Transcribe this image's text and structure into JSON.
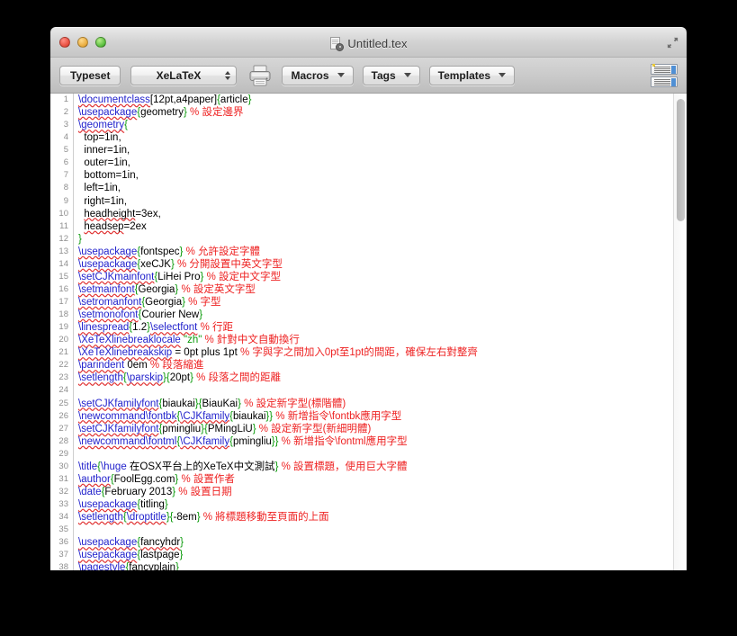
{
  "window": {
    "title": "Untitled.tex",
    "doc_icon": "tex-document-icon",
    "expand_icon": "expand-arrows-icon",
    "close_label": "close",
    "minimize_label": "minimize",
    "zoom_label": "zoom"
  },
  "toolbar": {
    "typeset_label": "Typeset",
    "engine_value": "XeLaTeX",
    "print_icon": "printer-icon",
    "macros_label": "Macros",
    "tags_label": "Tags",
    "templates_label": "Templates",
    "layout_toggle_icon": "split-view-icon"
  },
  "editor": {
    "line_count": 38,
    "first_visible_line": 1,
    "lines": [
      {
        "n": 1,
        "tokens": [
          {
            "c": "cmd-s",
            "t": "\\documentclass"
          },
          {
            "c": "txt",
            "t": "[12pt,a4paper]"
          },
          {
            "c": "br",
            "t": "{"
          },
          {
            "c": "txt",
            "t": "article"
          },
          {
            "c": "br",
            "t": "}"
          }
        ]
      },
      {
        "n": 2,
        "tokens": [
          {
            "c": "cmd-s",
            "t": "\\usepackage"
          },
          {
            "c": "br",
            "t": "{"
          },
          {
            "c": "txt",
            "t": "geometry"
          },
          {
            "c": "br",
            "t": "}"
          },
          {
            "c": "cmt",
            "t": " % 設定邊界"
          }
        ]
      },
      {
        "n": 3,
        "tokens": [
          {
            "c": "cmd-s",
            "t": "\\geometry"
          },
          {
            "c": "br",
            "t": "{"
          }
        ]
      },
      {
        "n": 4,
        "tokens": [
          {
            "c": "txt",
            "t": "  top=1in,"
          }
        ]
      },
      {
        "n": 5,
        "tokens": [
          {
            "c": "txt",
            "t": "  inner=1in,"
          }
        ]
      },
      {
        "n": 6,
        "tokens": [
          {
            "c": "txt",
            "t": "  outer=1in,"
          }
        ]
      },
      {
        "n": 7,
        "tokens": [
          {
            "c": "txt",
            "t": "  bottom=1in,"
          }
        ]
      },
      {
        "n": 8,
        "tokens": [
          {
            "c": "txt",
            "t": "  left=1in,"
          }
        ]
      },
      {
        "n": 9,
        "tokens": [
          {
            "c": "txt",
            "t": "  right=1in,"
          }
        ]
      },
      {
        "n": 10,
        "tokens": [
          {
            "c": "txt",
            "t": "  "
          },
          {
            "c": "sp",
            "t": "headheight"
          },
          {
            "c": "txt",
            "t": "=3ex,"
          }
        ]
      },
      {
        "n": 11,
        "tokens": [
          {
            "c": "txt",
            "t": "  "
          },
          {
            "c": "sp",
            "t": "headsep"
          },
          {
            "c": "txt",
            "t": "=2ex"
          }
        ]
      },
      {
        "n": 12,
        "tokens": [
          {
            "c": "br",
            "t": "}"
          }
        ]
      },
      {
        "n": 13,
        "tokens": [
          {
            "c": "cmd-s",
            "t": "\\usepackage"
          },
          {
            "c": "br",
            "t": "{"
          },
          {
            "c": "txt",
            "t": "fontspec"
          },
          {
            "c": "br",
            "t": "}"
          },
          {
            "c": "cmt",
            "t": " % 允許設定字體"
          }
        ]
      },
      {
        "n": 14,
        "tokens": [
          {
            "c": "cmd-s",
            "t": "\\usepackage"
          },
          {
            "c": "br",
            "t": "{"
          },
          {
            "c": "txt",
            "t": "xeCJK"
          },
          {
            "c": "br",
            "t": "}"
          },
          {
            "c": "cmt",
            "t": " % 分開設置中英文字型"
          }
        ]
      },
      {
        "n": 15,
        "tokens": [
          {
            "c": "cmd-s",
            "t": "\\setCJKmainfont"
          },
          {
            "c": "br",
            "t": "{"
          },
          {
            "c": "txt",
            "t": "LiHei Pro"
          },
          {
            "c": "br",
            "t": "}"
          },
          {
            "c": "cmt",
            "t": " % 設定中文字型"
          }
        ]
      },
      {
        "n": 16,
        "tokens": [
          {
            "c": "cmd-s",
            "t": "\\setmainfont"
          },
          {
            "c": "br",
            "t": "{"
          },
          {
            "c": "txt",
            "t": "Georgia"
          },
          {
            "c": "br",
            "t": "}"
          },
          {
            "c": "cmt",
            "t": " % 設定英文字型"
          }
        ]
      },
      {
        "n": 17,
        "tokens": [
          {
            "c": "cmd-s",
            "t": "\\setromanfont"
          },
          {
            "c": "br",
            "t": "{"
          },
          {
            "c": "txt",
            "t": "Georgia"
          },
          {
            "c": "br",
            "t": "}"
          },
          {
            "c": "cmt",
            "t": " % 字型"
          }
        ]
      },
      {
        "n": 18,
        "tokens": [
          {
            "c": "cmd-s",
            "t": "\\setmonofont"
          },
          {
            "c": "br",
            "t": "{"
          },
          {
            "c": "txt",
            "t": "Courier New"
          },
          {
            "c": "br",
            "t": "}"
          }
        ]
      },
      {
        "n": 19,
        "tokens": [
          {
            "c": "cmd-s",
            "t": "\\linespread"
          },
          {
            "c": "br",
            "t": "{"
          },
          {
            "c": "txt",
            "t": "1.2"
          },
          {
            "c": "br",
            "t": "}"
          },
          {
            "c": "cmd-s",
            "t": "\\selectfont"
          },
          {
            "c": "cmt",
            "t": " % 行距"
          }
        ]
      },
      {
        "n": 20,
        "tokens": [
          {
            "c": "cmd-s",
            "t": "\\XeTeXlinebreaklocale"
          },
          {
            "c": "txt",
            "t": " "
          },
          {
            "c": "str",
            "t": "\"zh\""
          },
          {
            "c": "cmt",
            "t": " % 針對中文自動換行"
          }
        ]
      },
      {
        "n": 21,
        "tokens": [
          {
            "c": "cmd-s",
            "t": "\\XeTeXlinebreakskip"
          },
          {
            "c": "txt",
            "t": " = 0pt plus 1pt "
          },
          {
            "c": "cmt",
            "t": "% 字與字之間加入0pt至1pt的間距，確保左右對整齊"
          }
        ]
      },
      {
        "n": 22,
        "tokens": [
          {
            "c": "cmd-s",
            "t": "\\parindent"
          },
          {
            "c": "txt",
            "t": " 0em "
          },
          {
            "c": "cmt",
            "t": "% 段落縮進"
          }
        ]
      },
      {
        "n": 23,
        "tokens": [
          {
            "c": "cmd-s",
            "t": "\\setlength"
          },
          {
            "c": "br",
            "t": "{"
          },
          {
            "c": "cmd-s",
            "t": "\\parskip"
          },
          {
            "c": "br",
            "t": "}{"
          },
          {
            "c": "txt",
            "t": "20pt"
          },
          {
            "c": "br",
            "t": "}"
          },
          {
            "c": "cmt",
            "t": " % 段落之間的距離"
          }
        ]
      },
      {
        "n": 24,
        "tokens": []
      },
      {
        "n": 25,
        "tokens": [
          {
            "c": "cmd-s",
            "t": "\\setCJKfamilyfont"
          },
          {
            "c": "br",
            "t": "{"
          },
          {
            "c": "txt",
            "t": "biaukai"
          },
          {
            "c": "br",
            "t": "}{"
          },
          {
            "c": "txt",
            "t": "BiauKai"
          },
          {
            "c": "br",
            "t": "}"
          },
          {
            "c": "cmt",
            "t": " % 設定新字型(標階體)"
          }
        ]
      },
      {
        "n": 26,
        "tokens": [
          {
            "c": "cmd-s",
            "t": "\\newcommand"
          },
          {
            "c": "cmd-s",
            "t": "\\fontbk"
          },
          {
            "c": "br",
            "t": "{"
          },
          {
            "c": "cmd-s",
            "t": "\\CJKfamily"
          },
          {
            "c": "br",
            "t": "{"
          },
          {
            "c": "txt",
            "t": "biaukai"
          },
          {
            "c": "br",
            "t": "}}"
          },
          {
            "c": "cmt",
            "t": " % 新增指令\\fontbk應用字型"
          }
        ]
      },
      {
        "n": 27,
        "tokens": [
          {
            "c": "cmd-s",
            "t": "\\setCJKfamilyfont"
          },
          {
            "c": "br",
            "t": "{"
          },
          {
            "c": "txt",
            "t": "pmingliu"
          },
          {
            "c": "br",
            "t": "}{"
          },
          {
            "c": "txt",
            "t": "PMingLiU"
          },
          {
            "c": "br",
            "t": "}"
          },
          {
            "c": "cmt",
            "t": " % 設定新字型(新細明體)"
          }
        ]
      },
      {
        "n": 28,
        "tokens": [
          {
            "c": "cmd-s",
            "t": "\\newcommand"
          },
          {
            "c": "cmd-s",
            "t": "\\fontml"
          },
          {
            "c": "br",
            "t": "{"
          },
          {
            "c": "cmd-s",
            "t": "\\CJKfamily"
          },
          {
            "c": "br",
            "t": "{"
          },
          {
            "c": "txt",
            "t": "pmingliu"
          },
          {
            "c": "br",
            "t": "}}"
          },
          {
            "c": "cmt",
            "t": " % 新增指令\\fontml應用字型"
          }
        ]
      },
      {
        "n": 29,
        "tokens": []
      },
      {
        "n": 30,
        "tokens": [
          {
            "c": "cmd",
            "t": "\\title"
          },
          {
            "c": "br",
            "t": "{"
          },
          {
            "c": "cmd",
            "t": "\\huge"
          },
          {
            "c": "txt",
            "t": " 在OSX平台上的XeTeX中文測試"
          },
          {
            "c": "br",
            "t": "}"
          },
          {
            "c": "cmt",
            "t": " % 設置標題，使用巨大字體"
          }
        ]
      },
      {
        "n": 31,
        "tokens": [
          {
            "c": "cmd-s",
            "t": "\\author"
          },
          {
            "c": "br",
            "t": "{"
          },
          {
            "c": "txt",
            "t": "FoolEgg.com"
          },
          {
            "c": "br",
            "t": "}"
          },
          {
            "c": "cmt",
            "t": " % 設置作者"
          }
        ]
      },
      {
        "n": 32,
        "tokens": [
          {
            "c": "cmd",
            "t": "\\date"
          },
          {
            "c": "br",
            "t": "{"
          },
          {
            "c": "txt",
            "t": "February 2013"
          },
          {
            "c": "br",
            "t": "}"
          },
          {
            "c": "cmt",
            "t": " % 設置日期"
          }
        ]
      },
      {
        "n": 33,
        "tokens": [
          {
            "c": "cmd-s",
            "t": "\\usepackage"
          },
          {
            "c": "br",
            "t": "{"
          },
          {
            "c": "txt",
            "t": "titling"
          },
          {
            "c": "br",
            "t": "}"
          }
        ]
      },
      {
        "n": 34,
        "tokens": [
          {
            "c": "cmd-s",
            "t": "\\setlength"
          },
          {
            "c": "br",
            "t": "{"
          },
          {
            "c": "cmd-s",
            "t": "\\droptitle"
          },
          {
            "c": "br",
            "t": "}{"
          },
          {
            "c": "txt",
            "t": "-8em"
          },
          {
            "c": "br",
            "t": "}"
          },
          {
            "c": "cmt",
            "t": " % 將標題移動至頁面的上面"
          }
        ]
      },
      {
        "n": 35,
        "tokens": []
      },
      {
        "n": 36,
        "tokens": [
          {
            "c": "cmd-s",
            "t": "\\usepackage"
          },
          {
            "c": "br",
            "t": "{"
          },
          {
            "c": "sp",
            "t": "fancyhdr"
          },
          {
            "c": "br",
            "t": "}"
          }
        ]
      },
      {
        "n": 37,
        "tokens": [
          {
            "c": "cmd-s",
            "t": "\\usepackage"
          },
          {
            "c": "br",
            "t": "{"
          },
          {
            "c": "txt",
            "t": "lastpage"
          },
          {
            "c": "br",
            "t": "}"
          }
        ]
      },
      {
        "n": 38,
        "tokens": [
          {
            "c": "cmd",
            "t": "\\pagestyle"
          },
          {
            "c": "br",
            "t": "{"
          },
          {
            "c": "txt",
            "t": "fancyplain"
          },
          {
            "c": "br",
            "t": "}"
          }
        ]
      }
    ]
  },
  "colors": {
    "command": "#2222cc",
    "brace": "#0a9a0a",
    "comment": "#ee2222",
    "text": "#000000",
    "spell_underline": "#e03030",
    "editor_background": "#ffffff",
    "gutter_text": "#8e8e8e"
  }
}
